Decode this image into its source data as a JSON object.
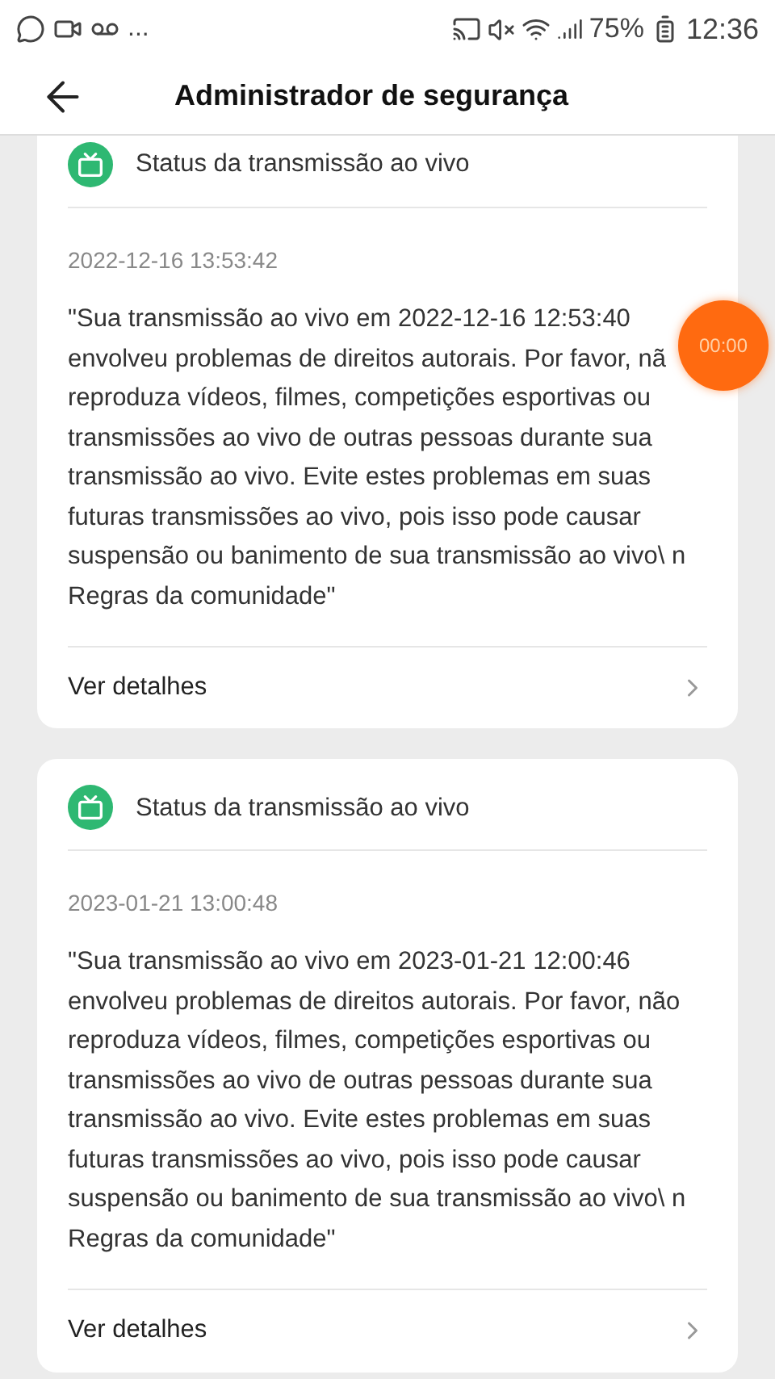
{
  "status_bar": {
    "more": "...",
    "battery": "75%",
    "time": "12:36"
  },
  "header": {
    "title": "Administrador de segurança"
  },
  "cards": [
    {
      "title": "Status da transmissão ao vivo",
      "date": "2022-12-16 13:53:42",
      "message": "\"Sua transmissão ao vivo em 2022-12-16 12:53:40 envolveu problemas de direitos autorais. Por favor, nã reproduza vídeos, filmes, competições esportivas ou transmissões ao vivo de outras pessoas durante sua transmissão ao vivo. Evite estes problemas em suas futuras transmissões ao vivo, pois isso pode causar suspensão ou banimento de sua transmissão ao vivo\\ n Regras da comunidade\"",
      "link": "Ver detalhes"
    },
    {
      "title": "Status da transmissão ao vivo",
      "date": "2023-01-21 13:00:48",
      "message": "\"Sua transmissão ao vivo em 2023-01-21 12:00:46 envolveu problemas de direitos autorais. Por favor, não reproduza vídeos, filmes, competições esportivas ou transmissões ao vivo de outras pessoas durante sua transmissão ao vivo. Evite estes problemas em suas futuras transmissões ao vivo, pois isso pode causar suspensão ou banimento de sua transmissão ao vivo\\ n Regras da comunidade\"",
      "link": "Ver detalhes"
    }
  ],
  "floating_timer": {
    "label": "00:00"
  }
}
